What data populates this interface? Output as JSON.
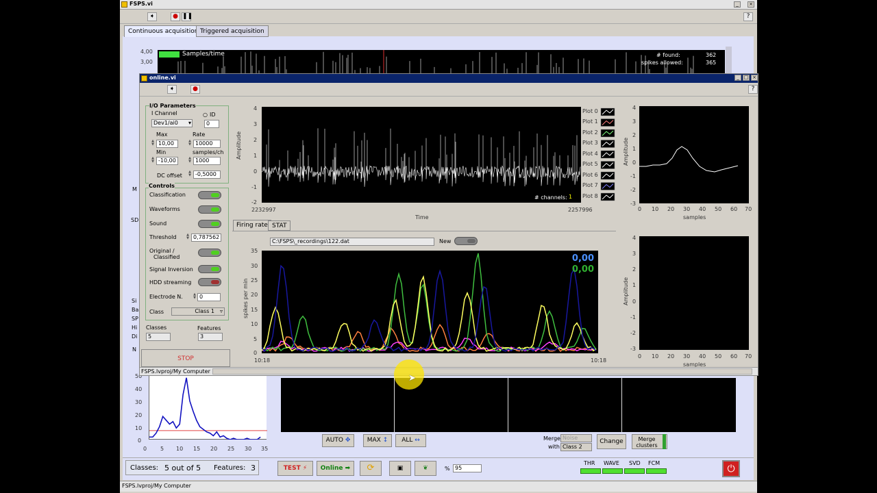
{
  "outer": {
    "title": "FSPS.vi",
    "tabs": [
      "Continuous acquisition",
      "Triggered acquisition"
    ],
    "top_plot": {
      "yticks": [
        "4,00",
        "3,00"
      ],
      "legend": "Samples/time",
      "found_label": "# found:",
      "found_value": "362",
      "allowed_label": "spikes allowed:",
      "allowed_value": "365"
    },
    "side_letters": {
      "m": "M",
      "sd": "SD",
      "list": [
        "Si",
        "Ba",
        "SP",
        "Hi",
        "Di"
      ],
      "n": "N"
    },
    "hist": {
      "yticks": [
        "50",
        "40",
        "30",
        "20",
        "10",
        "0"
      ],
      "xticks": [
        "0",
        "5",
        "10",
        "15",
        "20",
        "25",
        "30",
        "35"
      ]
    },
    "buttons": {
      "auto": "AUTO",
      "max": "MAX",
      "all": "ALL",
      "merge_with1": "Merge",
      "merge_with2": "with",
      "noise": "Noise",
      "class2": "Class 2",
      "change": "Change",
      "merge_clusters": "Merge clusters"
    },
    "status": {
      "classes_label": "Classes:",
      "classes_value": "5 out of 5",
      "features_label": "Features:",
      "features_value": "3",
      "test": "TEST",
      "online": "Online",
      "percent_label": "%",
      "percent_value": "95"
    },
    "leds": [
      "THR",
      "WAVE",
      "SVD",
      "FCM"
    ],
    "path": "FSPS.lvproj/My Computer"
  },
  "inner": {
    "title": "online.vi",
    "io": {
      "header": "I/O Parameters",
      "channel_label": "I Channel",
      "channel_value": "Dev1/ai0",
      "id_label": "ID",
      "id_value": "0",
      "max_label": "Max",
      "max_value": "10,00",
      "rate_label": "Rate",
      "rate_value": "10000",
      "min_label": "Min",
      "min_value": "-10,00",
      "spc_label": "samples/ch",
      "spc_value": "1000",
      "dc_label": "DC offset",
      "dc_value": "-0,5000"
    },
    "controls": {
      "header": "Controls",
      "classification": "Classification",
      "waveforms": "Waveforms",
      "sound": "Sound",
      "threshold_label": "Threshold",
      "threshold_value": "0,787562",
      "original1": "Original /",
      "original2": "Classified",
      "inversion": "Signal Inversion",
      "hdd": "HDD streaming",
      "electrode_label": "Electrode N.",
      "electrode_value": "0",
      "class_label": "Class",
      "class_value": "Class 1"
    },
    "classes_label": "Classes",
    "classes_value": "5",
    "features_label": "Features",
    "features_value": "3",
    "stop": "STOP",
    "path": "FSPS.lvproj/My Computer",
    "raw_plot": {
      "ylabel": "Amplitude",
      "xlabel": "Time",
      "yticks": [
        "4",
        "3",
        "2",
        "1",
        "0",
        "-1",
        "-2"
      ],
      "xstart": "2232997",
      "xend": "2257996",
      "channels_label": "# channels:",
      "channels_value": "1",
      "legend": [
        "Plot 0",
        "Plot 1",
        "Plot 2",
        "Plot 3",
        "Plot 4",
        "Plot 5",
        "Plot 6",
        "Plot 7",
        "Plot 8"
      ]
    },
    "wave_plot": {
      "ylabel": "Amplitude",
      "xlabel": "samples",
      "yticks": [
        "4",
        "3",
        "2",
        "1",
        "0",
        "-1",
        "-2",
        "-3"
      ],
      "xticks": [
        "0",
        "10",
        "20",
        "30",
        "40",
        "50",
        "60",
        "70"
      ]
    },
    "tabs2": [
      "Firing rate",
      "STAT"
    ],
    "file_path": "C:\\FSPS\\_recordings\\122.dat",
    "new_label": "New",
    "rate_plot": {
      "ylabel": "spikes per min",
      "yticks": [
        "35",
        "30",
        "25",
        "20",
        "15",
        "10",
        "5",
        "0"
      ],
      "xstart": "10:18",
      "xend": "10:18",
      "value1": "0,00",
      "value2": "0,00"
    },
    "wave_plot2": {
      "ylabel": "Amplitude",
      "xlabel": "samples",
      "yticks": [
        "4",
        "3",
        "2",
        "1",
        "0",
        "-1",
        "-2",
        "-3"
      ],
      "xticks": [
        "0",
        "10",
        "20",
        "30",
        "40",
        "50",
        "60",
        "70"
      ]
    }
  },
  "colors": {
    "blue_series": "#1818a0",
    "green_series": "#40c040",
    "yellow_series": "#ffff60",
    "orange_series": "#ff8040",
    "magenta_series": "#ff40ff"
  },
  "chart_data": [
    {
      "type": "line",
      "title": "",
      "xlabel": "",
      "ylabel": "",
      "x": [
        0,
        1,
        2,
        3,
        4,
        5,
        6,
        7,
        8,
        9,
        10,
        11,
        12,
        13,
        14,
        15,
        16,
        17,
        18,
        19,
        20,
        21,
        22,
        23,
        24,
        25,
        26,
        27,
        28,
        29,
        30,
        31,
        32,
        33
      ],
      "series": [
        {
          "values": [
            2,
            2,
            5,
            10,
            18,
            15,
            12,
            14,
            9,
            12,
            35,
            48,
            30,
            22,
            15,
            10,
            8,
            6,
            5,
            3,
            6,
            2,
            3,
            1,
            0,
            1,
            0,
            0,
            0,
            1,
            0,
            0,
            0,
            2
          ]
        }
      ],
      "xlim": [
        0,
        35
      ],
      "ylim": [
        0,
        50
      ],
      "threshold": 7
    }
  ]
}
